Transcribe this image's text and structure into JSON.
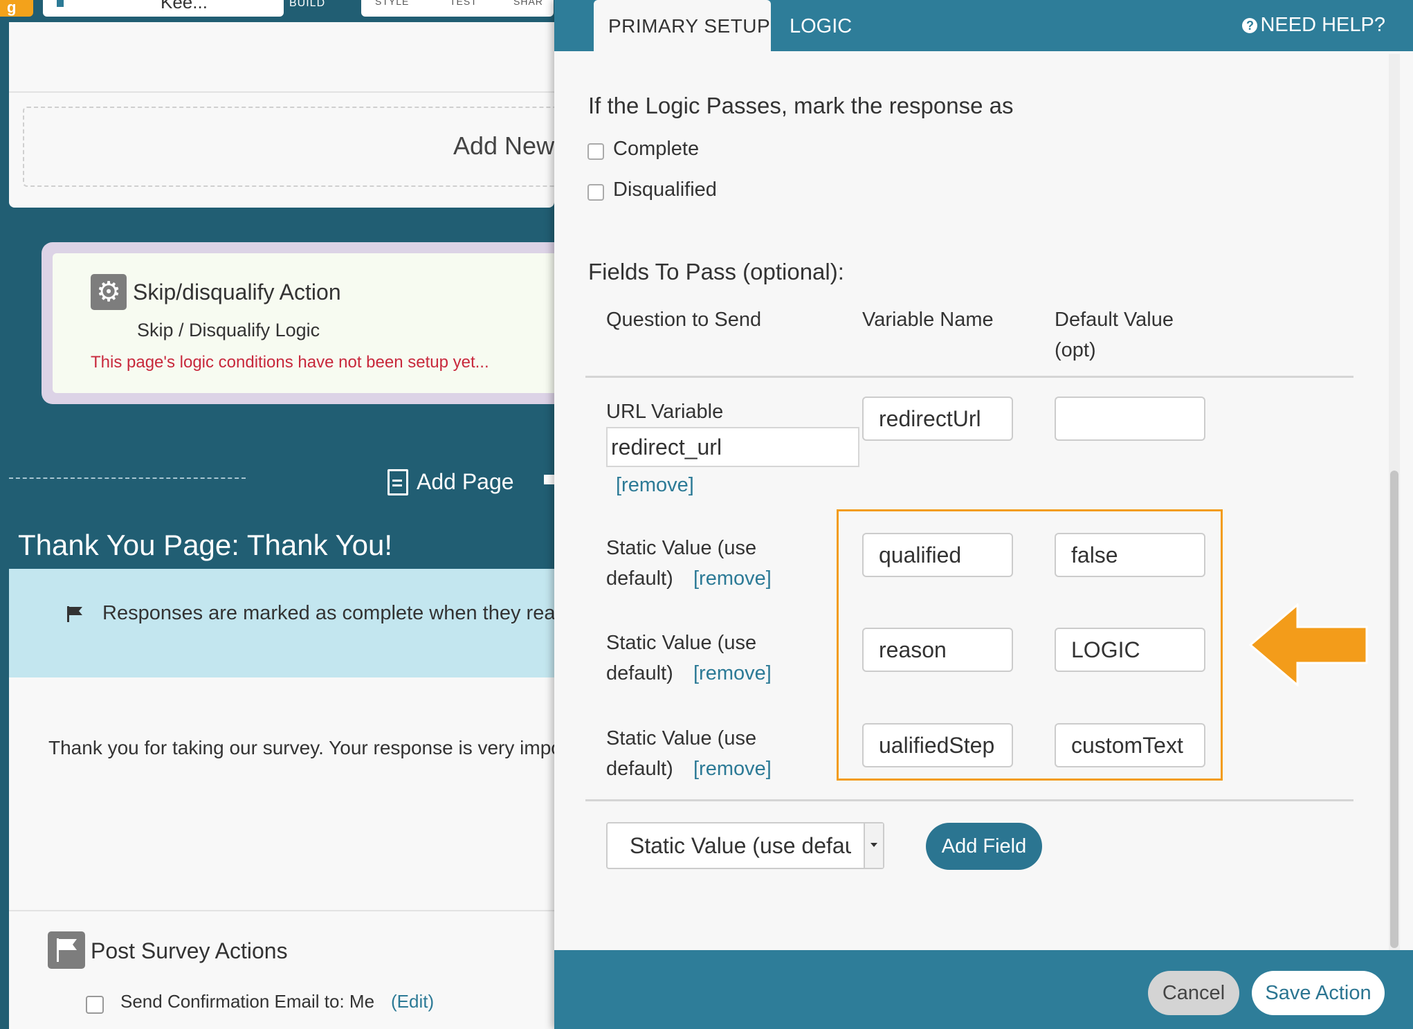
{
  "background": {
    "logo_glyph": "g",
    "survey_title": "Kee...",
    "nav_build": "BUILD",
    "nav_tabs": [
      "STYLE",
      "TEST",
      "SHAR"
    ],
    "add_new": "Add New",
    "skip_card": {
      "title": "Skip/disqualify Action",
      "subtitle": "Skip / Disqualify Logic",
      "warning": "This page's logic conditions have not been setup yet..."
    },
    "add_page": "Add Page",
    "thank_you_title": "Thank You Page: Thank You!",
    "banner_text": "Responses are marked as complete when they reach",
    "thank_text": "Thank you for taking our survey. Your response is very impor",
    "post_survey": {
      "title": "Post Survey Actions",
      "email_label": "Send Confirmation Email to: Me",
      "edit_link": "(Edit)"
    }
  },
  "modal": {
    "tabs": [
      {
        "label": "PRIMARY SETUP",
        "active": true
      },
      {
        "label": "LOGIC",
        "active": false
      }
    ],
    "need_help": "NEED HELP?",
    "pass_heading": "If the Logic Passes, mark the response as",
    "checkboxes": [
      {
        "label": "Complete",
        "checked": false
      },
      {
        "label": "Disqualified",
        "checked": false
      }
    ],
    "fields_heading": "Fields To Pass (optional):",
    "columns": {
      "question": "Question to Send",
      "variable": "Variable Name",
      "default_line1": "Default Value",
      "default_line2": "(opt)"
    },
    "rows": [
      {
        "label": "URL Variable",
        "url_value": "redirect_url",
        "remove": "[remove]",
        "variable": "redirectUrl",
        "default": ""
      },
      {
        "label_line1": "Static Value (use",
        "label_line2": "default)",
        "remove": "[remove]",
        "variable": "qualified",
        "default": "false"
      },
      {
        "label_line1": "Static Value (use",
        "label_line2": "default)",
        "remove": "[remove]",
        "variable": "reason",
        "default": "LOGIC"
      },
      {
        "label_line1": "Static Value (use",
        "label_line2": "default)",
        "remove": "[remove]",
        "variable": "ualifiedStep",
        "default": "customText"
      }
    ],
    "field_type_select": "Static Value (use defau",
    "add_field": "Add Field",
    "cancel": "Cancel",
    "save": "Save Action"
  },
  "colors": {
    "accent": "#2e7d99",
    "highlight": "#f39c1a",
    "warning": "#c8283c"
  },
  "icons": [
    "gear-icon",
    "doc-icon",
    "flag-icon",
    "help-icon",
    "arrow-left-icon",
    "caret-down-icon"
  ]
}
